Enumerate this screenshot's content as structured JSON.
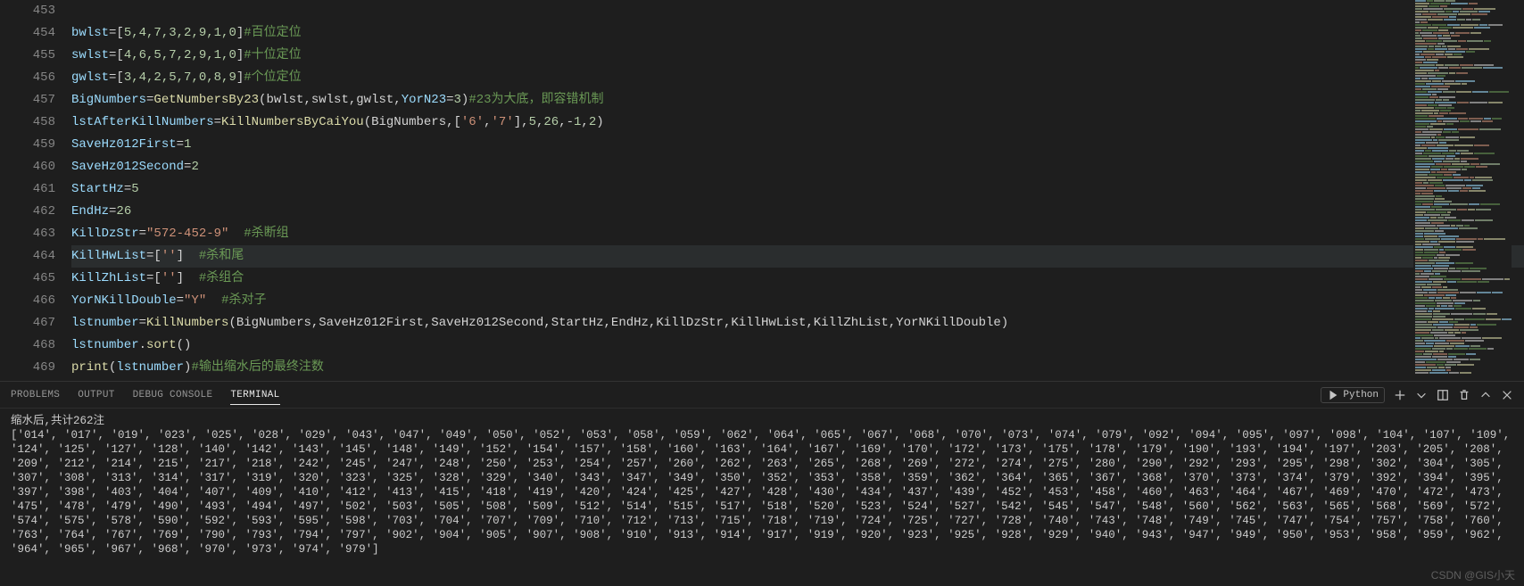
{
  "gutter": [
    "453",
    "454",
    "455",
    "456",
    "457",
    "458",
    "459",
    "460",
    "461",
    "462",
    "463",
    "464",
    "465",
    "466",
    "467",
    "468",
    "469"
  ],
  "code": {
    "l454": {
      "v1": "bwlst",
      "eq": "=",
      "b1": "[",
      "nums": "5,4,7,3,2,9,1,0",
      "b2": "]",
      "cmt": "#百位定位"
    },
    "l455": {
      "v1": "swlst",
      "eq": "=",
      "b1": "[",
      "nums": "4,6,5,7,2,9,1,0",
      "b2": "]",
      "cmt": "#十位定位"
    },
    "l456": {
      "v1": "gwlst",
      "eq": "=",
      "b1": "[",
      "nums": "3,4,2,5,7,0,8,9",
      "b2": "]",
      "cmt": "#个位定位"
    },
    "l457": {
      "v1": "BigNumbers",
      "eq": "=",
      "fn": "GetNumbersBy23",
      "args1": "(bwlst,swlst,gwlst,",
      "kw": "YorN23",
      "eq2": "=",
      "n": "3",
      "args2": ")",
      "cmt": "#23为大底，即容错机制"
    },
    "l458": {
      "v1": "lstAfterKillNumbers",
      "eq": "=",
      "fn": "KillNumbersByCaiYou",
      "p1": "(BigNumbers,[",
      "s1": "'6'",
      "c1": ",",
      "s2": "'7'",
      "p2": "],",
      "n1": "5",
      "c2": ",",
      "n2": "26",
      "c3": ",-",
      "n3": "1",
      "c4": ",",
      "n4": "2",
      "p3": ")"
    },
    "l459": {
      "v1": "SaveHz012First",
      "eq": "=",
      "n": "1"
    },
    "l460": {
      "v1": "SaveHz012Second",
      "eq": "=",
      "n": "2"
    },
    "l461": {
      "v1": "StartHz",
      "eq": "=",
      "n": "5"
    },
    "l462": {
      "v1": "EndHz",
      "eq": "=",
      "n": "26"
    },
    "l463": {
      "v1": "KillDzStr",
      "eq": "=",
      "s": "\"572-452-9\"",
      "sp": "  ",
      "cmt": "#杀断组"
    },
    "l464": {
      "v1": "KillHwList",
      "eq": "=[",
      "s": "''",
      "b": "]  ",
      "cmt": "#杀和尾"
    },
    "l465": {
      "v1": "KillZhList",
      "eq": "=[",
      "s": "''",
      "b": "]  ",
      "cmt": "#杀组合"
    },
    "l466": {
      "v1": "YorNKillDouble",
      "eq": "=",
      "s": "\"Y\"",
      "sp": "  ",
      "cmt": "#杀对子"
    },
    "l467": {
      "v1": "lstnumber",
      "eq": "=",
      "fn": "KillNumbers",
      "args": "(BigNumbers,SaveHz012First,SaveHz012Second,StartHz,EndHz,KillDzStr,KillHwList,KillZhList,YorNKillDouble)"
    },
    "l468": {
      "v1": "lstnumber",
      "dot": ".",
      "fn": "sort",
      "p": "()"
    },
    "l469": {
      "fn": "print",
      "p1": "(",
      "v": "lstnumber",
      "p2": ")",
      "cmt": "#输出缩水后的最终注数"
    }
  },
  "tabs": {
    "problems": "PROBLEMS",
    "output": "OUTPUT",
    "debug": "DEBUG CONSOLE",
    "terminal": "TERMINAL"
  },
  "lang": "Python",
  "term_header": "缩水后,共计262注",
  "term_list": [
    "014",
    "017",
    "019",
    "023",
    "025",
    "028",
    "029",
    "043",
    "047",
    "049",
    "050",
    "052",
    "053",
    "058",
    "059",
    "062",
    "064",
    "065",
    "067",
    "068",
    "070",
    "073",
    "074",
    "079",
    "092",
    "094",
    "095",
    "097",
    "098",
    "104",
    "107",
    "109",
    "124",
    "125",
    "127",
    "128",
    "140",
    "142",
    "143",
    "145",
    "148",
    "149",
    "152",
    "154",
    "157",
    "158",
    "160",
    "163",
    "164",
    "167",
    "169",
    "170",
    "172",
    "173",
    "175",
    "178",
    "179",
    "190",
    "193",
    "194",
    "197",
    "203",
    "205",
    "208",
    "209",
    "212",
    "214",
    "215",
    "217",
    "218",
    "242",
    "245",
    "247",
    "248",
    "250",
    "253",
    "254",
    "257",
    "260",
    "262",
    "263",
    "265",
    "268",
    "269",
    "272",
    "274",
    "275",
    "280",
    "290",
    "292",
    "293",
    "295",
    "298",
    "302",
    "304",
    "305",
    "307",
    "308",
    "313",
    "314",
    "317",
    "319",
    "320",
    "323",
    "325",
    "328",
    "329",
    "340",
    "343",
    "347",
    "349",
    "350",
    "352",
    "353",
    "358",
    "359",
    "362",
    "364",
    "365",
    "367",
    "368",
    "370",
    "373",
    "374",
    "379",
    "392",
    "394",
    "395",
    "397",
    "398",
    "403",
    "404",
    "407",
    "409",
    "410",
    "412",
    "413",
    "415",
    "418",
    "419",
    "420",
    "424",
    "425",
    "427",
    "428",
    "430",
    "434",
    "437",
    "439",
    "452",
    "453",
    "458",
    "460",
    "463",
    "464",
    "467",
    "469",
    "470",
    "472",
    "473",
    "475",
    "478",
    "479",
    "490",
    "493",
    "494",
    "497",
    "502",
    "503",
    "505",
    "508",
    "509",
    "512",
    "514",
    "515",
    "517",
    "518",
    "520",
    "523",
    "524",
    "527",
    "542",
    "545",
    "547",
    "548",
    "560",
    "562",
    "563",
    "565",
    "568",
    "569",
    "572",
    "574",
    "575",
    "578",
    "590",
    "592",
    "593",
    "595",
    "598",
    "703",
    "704",
    "707",
    "709",
    "710",
    "712",
    "713",
    "715",
    "718",
    "719",
    "724",
    "725",
    "727",
    "728",
    "740",
    "743",
    "748",
    "749",
    "745",
    "747",
    "754",
    "757",
    "758",
    "760",
    "763",
    "764",
    "767",
    "769",
    "790",
    "793",
    "794",
    "797",
    "902",
    "904",
    "905",
    "907",
    "908",
    "910",
    "913",
    "914",
    "917",
    "919",
    "920",
    "923",
    "925",
    "928",
    "929",
    "940",
    "943",
    "947",
    "949",
    "950",
    "953",
    "958",
    "959",
    "962",
    "964",
    "965",
    "967",
    "968",
    "970",
    "973",
    "974",
    "979"
  ],
  "watermark": "CSDN @GIS小天"
}
